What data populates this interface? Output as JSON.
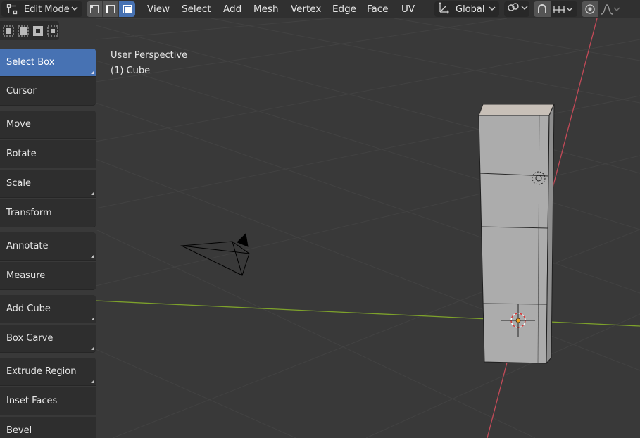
{
  "header": {
    "mode": "Edit Mode",
    "menus": [
      "View",
      "Select",
      "Add",
      "Mesh",
      "Vertex",
      "Edge",
      "Face",
      "UV"
    ],
    "orientation": "Global"
  },
  "viewport": {
    "perspective_label": "User Perspective",
    "object_label": "(1) Cube"
  },
  "toolbar": {
    "tools": [
      "Select Box",
      "Cursor",
      "Move",
      "Rotate",
      "Scale",
      "Transform",
      "Annotate",
      "Measure",
      "Add Cube",
      "Box Carve",
      "Extrude Region",
      "Inset Faces",
      "Bevel"
    ],
    "active_tool": "Select Box"
  },
  "colors": {
    "accent": "#4772b3",
    "viewport_bg": "#393939",
    "grid_line": "#424242",
    "x_axis": "#c34a58",
    "y_axis": "#7ea22b",
    "mesh_face": "#aaaaaa"
  }
}
